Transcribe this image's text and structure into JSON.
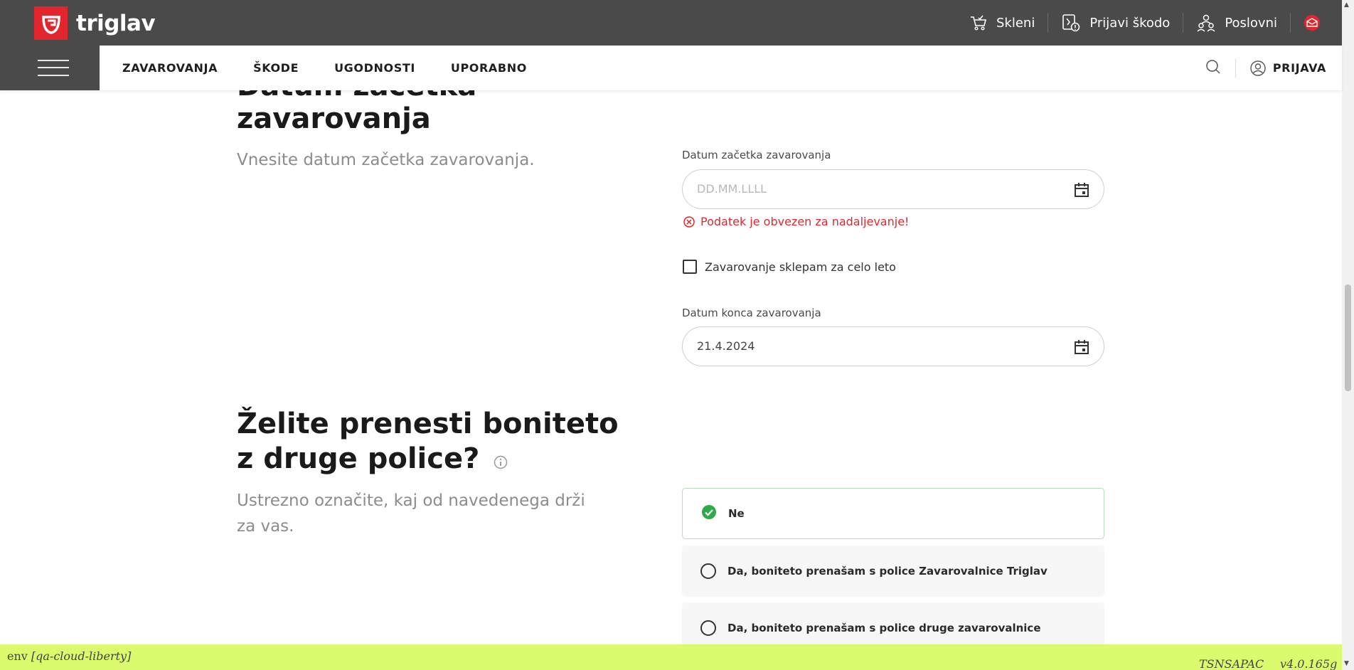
{
  "header": {
    "brand": "triglav",
    "actions": [
      {
        "label": "Skleni",
        "icon": "cart-icon"
      },
      {
        "label": "Prijavi škodo",
        "icon": "report-damage-icon"
      },
      {
        "label": "Poslovni",
        "icon": "business-users-icon"
      }
    ],
    "mail_icon": "mail-icon",
    "colors": {
      "brand_red": "#e3262e",
      "topbar": "#4a4a4a"
    }
  },
  "nav": {
    "links": [
      "ZAVAROVANJA",
      "ŠKODE",
      "UGODNOSTI",
      "UPORABNO"
    ],
    "login_label": "PRIJAVA"
  },
  "section1": {
    "title_line1": "Datum začetka",
    "title_line2": "zavarovanja",
    "subtitle": "Vnesite datum začetka zavarovanja.",
    "start_label": "Datum začetka zavarovanja",
    "start_placeholder": "DD.MM.LLLL",
    "start_value": "",
    "error": "Podatek je obvezen za nadaljevanje!",
    "checkbox_label": "Zavarovanje sklepam za celo leto",
    "checkbox_checked": false,
    "end_label": "Datum konca zavarovanja",
    "end_value": "21.4.2024"
  },
  "section2": {
    "title_line1": "Želite prenesti boniteto",
    "title_line2": "z druge police?",
    "subtitle_line1": "Ustrezno označite, kaj od navedenega drži",
    "subtitle_line2": "za vas.",
    "options": [
      {
        "label": "Ne",
        "selected": true
      },
      {
        "label": "Da, boniteto prenašam s police Zavarovalnice Triglav",
        "selected": false
      },
      {
        "label": "Da, boniteto prenašam s police druge zavarovalnice",
        "selected": false
      }
    ]
  },
  "envbar": {
    "env_prefix": "env ",
    "env_name": "[qa-cloud-liberty]",
    "code": "TSNSAPAC",
    "version": "v4.0.165g"
  }
}
